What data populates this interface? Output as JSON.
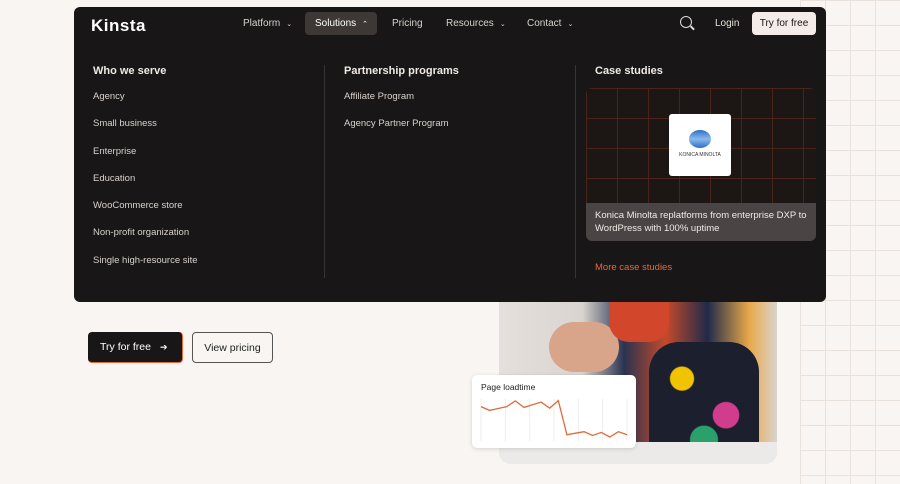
{
  "header": {
    "logo": "Kinsta",
    "nav": [
      {
        "label": "Platform"
      },
      {
        "label": "Solutions"
      },
      {
        "label": "Pricing"
      },
      {
        "label": "Resources"
      },
      {
        "label": "Contact"
      }
    ],
    "login": "Login",
    "cta": "Try for free"
  },
  "menu": {
    "who": {
      "title": "Who we serve",
      "items": [
        "Agency",
        "Small business",
        "Enterprise",
        "Education",
        "WooCommerce store",
        "Non-profit organization",
        "Single high-resource site"
      ]
    },
    "partner": {
      "title": "Partnership programs",
      "items": [
        "Affiliate Program",
        "Agency Partner Program"
      ]
    },
    "cases": {
      "title": "Case studies",
      "logo_text": "KONICA MINOLTA",
      "caption": "Konica Minolta replatforms from enterprise DXP to WordPress with 100% uptime",
      "more": "More case studies"
    }
  },
  "hero": {
    "try": "Try for free",
    "pricing": "View pricing"
  },
  "widget": {
    "title": "Page loadtime",
    "values": [
      8,
      7,
      7.5,
      8,
      9.5,
      7.8,
      8.5,
      9.2,
      7.6,
      9.6,
      0.6,
      1,
      1.4,
      0.4,
      1.2,
      0,
      1.4,
      0.6
    ],
    "color": "#e06a3a"
  }
}
